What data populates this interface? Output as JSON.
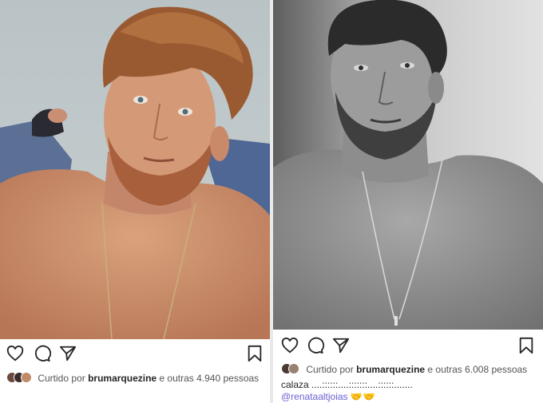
{
  "left_post": {
    "liked_by_label": "Curtido por",
    "liked_by_user": "brumarquezine",
    "others_text": "e outras 4.940 pessoas",
    "icons": [
      "heart-icon",
      "comment-icon",
      "share-icon",
      "bookmark-icon"
    ]
  },
  "right_post": {
    "liked_by_label": "Curtido por",
    "liked_by_user": "brumarquezine",
    "others_text": "e outras 6.008 pessoas",
    "caption_line": "calaza ....::::::....:::::::....::::::.......",
    "mention": "@renataaltjoias",
    "emoji": "🤝🤝",
    "icons": [
      "heart-icon",
      "comment-icon",
      "share-icon",
      "bookmark-icon"
    ]
  },
  "colors": {
    "text": "#262626",
    "mention": "#6a5fd0",
    "background": "#ffffff"
  }
}
